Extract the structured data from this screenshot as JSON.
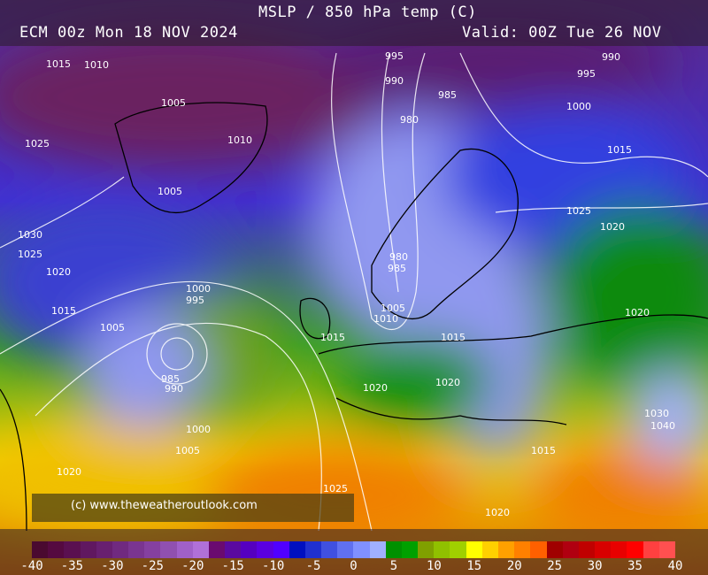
{
  "header": {
    "title": "MSLP / 850 hPa temp (C)",
    "run": "ECM 00z Mon 18 NOV 2024",
    "valid": "Valid: 00Z Tue 26 NOV"
  },
  "copyright": "(c) www.theweatheroutlook.com",
  "colorbar": {
    "ticks": [
      "-40",
      "-35",
      "-30",
      "-25",
      "-20",
      "-15",
      "-10",
      "-5",
      "0",
      "5",
      "10",
      "15",
      "20",
      "25",
      "30",
      "35",
      "40"
    ],
    "colors": [
      "#4a0a30",
      "#550a40",
      "#5a1050",
      "#601860",
      "#682070",
      "#702a80",
      "#7a3590",
      "#8540a0",
      "#9050b0",
      "#a060c8",
      "#b070d8",
      "#6a0a70",
      "#5a0aa0",
      "#5500c0",
      "#5a00e0",
      "#5000ff",
      "#0010c0",
      "#2030d0",
      "#4050e0",
      "#6070f0",
      "#8090ff",
      "#a0b0ff",
      "#009000",
      "#00a000",
      "#80a000",
      "#90c000",
      "#a0d000",
      "#ffff00",
      "#ffd000",
      "#ffa000",
      "#ff8000",
      "#ff6000",
      "#a00000",
      "#b00010",
      "#c00000",
      "#d80000",
      "#e80000",
      "#ff0000",
      "#ff4040",
      "#ff5050"
    ]
  },
  "isobars": [
    "1015",
    "1010",
    "995",
    "990",
    "985",
    "980",
    "995",
    "990",
    "1005",
    "1010",
    "1000",
    "1015",
    "1025",
    "1005",
    "1030",
    "1025",
    "1020",
    "1015",
    "1005",
    "1000",
    "995",
    "985",
    "990",
    "1000",
    "1005",
    "980",
    "985",
    "1005",
    "1010",
    "1015",
    "1015",
    "1020",
    "1020",
    "1025",
    "1015",
    "1020",
    "1020",
    "1030",
    "1040",
    "1025",
    "1020",
    "1020"
  ]
}
